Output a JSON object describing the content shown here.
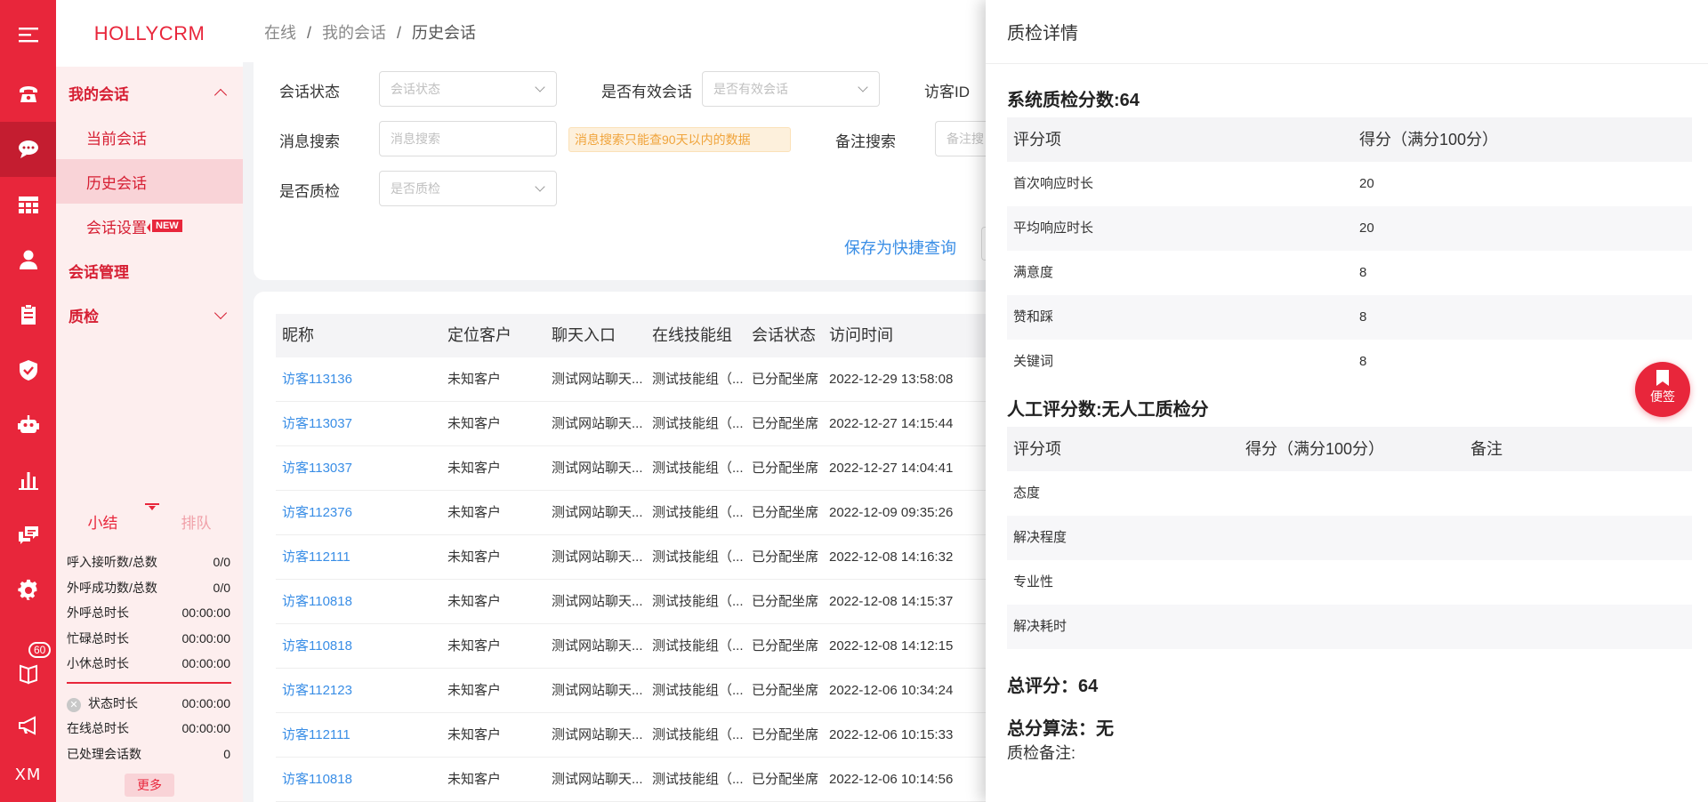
{
  "app": {
    "brand": "HOLLYCRM"
  },
  "rail": {
    "icons": [
      "menu-icon",
      "phone-icon",
      "chat-icon",
      "grid-icon",
      "user-icon",
      "clipboard-icon",
      "shield-icon",
      "robot-icon",
      "bar-chart-icon",
      "message-icon",
      "gear-icon",
      "book-icon",
      "megaphone-icon",
      "xm-icon"
    ],
    "badge": "60",
    "xm_label": "XM"
  },
  "menu": {
    "group1": "我的会话",
    "items": [
      "当前会话",
      "历史会话",
      "会话设置"
    ],
    "new_badge": "NEW",
    "group2": "会话管理",
    "group3": "质检"
  },
  "summary": {
    "tab1": "小结",
    "tab2": "排队",
    "rows": [
      {
        "label": "呼入接听数/总数",
        "value": "0/0"
      },
      {
        "label": "外呼成功数/总数",
        "value": "0/0"
      },
      {
        "label": "外呼总时长",
        "value": "00:00:00"
      },
      {
        "label": "忙碌总时长",
        "value": "00:00:00"
      },
      {
        "label": "小休总时长",
        "value": "00:00:00"
      }
    ],
    "rows2": [
      {
        "label": "状态时长",
        "value": "00:00:00"
      },
      {
        "label": "在线总时长",
        "value": "00:00:00"
      },
      {
        "label": "已处理会话数",
        "value": "0"
      }
    ],
    "more": "更多"
  },
  "breadcrumb": [
    "在线",
    "我的会话",
    "历史会话"
  ],
  "filters": {
    "status_label": "会话状态",
    "status_placeholder": "会话状态",
    "valid_label": "是否有效会话",
    "valid_placeholder": "是否有效会话",
    "visitor_label": "访客ID",
    "msg_label": "消息搜索",
    "msg_placeholder": "消息搜索",
    "msg_tip": "消息搜索只能查90天以内的数据",
    "remark_label": "备注搜索",
    "remark_placeholder": "备注搜",
    "qc_label": "是否质检",
    "qc_placeholder": "是否质检",
    "save_link": "保存为快捷查询"
  },
  "table": {
    "headers": [
      "昵称",
      "定位客户",
      "聊天入口",
      "在线技能组",
      "会话状态",
      "访问时间"
    ],
    "rows": [
      [
        "访客113136",
        "未知客户",
        "测试网站聊天...",
        "测试技能组（...",
        "已分配坐席",
        "2022-12-29 13:58:08"
      ],
      [
        "访客113037",
        "未知客户",
        "测试网站聊天...",
        "测试技能组（...",
        "已分配坐席",
        "2022-12-27 14:15:44"
      ],
      [
        "访客113037",
        "未知客户",
        "测试网站聊天...",
        "测试技能组（...",
        "已分配坐席",
        "2022-12-27 14:04:41"
      ],
      [
        "访客112376",
        "未知客户",
        "测试网站聊天...",
        "测试技能组（...",
        "已分配坐席",
        "2022-12-09 09:35:26"
      ],
      [
        "访客112111",
        "未知客户",
        "测试网站聊天...",
        "测试技能组（...",
        "已分配坐席",
        "2022-12-08 14:16:32"
      ],
      [
        "访客110818",
        "未知客户",
        "测试网站聊天...",
        "测试技能组（...",
        "已分配坐席",
        "2022-12-08 14:15:37"
      ],
      [
        "访客110818",
        "未知客户",
        "测试网站聊天...",
        "测试技能组（...",
        "已分配坐席",
        "2022-12-08 14:12:15"
      ],
      [
        "访客112123",
        "未知客户",
        "测试网站聊天...",
        "测试技能组（...",
        "已分配坐席",
        "2022-12-06 10:34:24"
      ],
      [
        "访客112111",
        "未知客户",
        "测试网站聊天...",
        "测试技能组（...",
        "已分配坐席",
        "2022-12-06 10:15:33"
      ],
      [
        "访客110818",
        "未知客户",
        "测试网站聊天...",
        "测试技能组（...",
        "已分配坐席",
        "2022-12-06 10:14:56"
      ]
    ]
  },
  "drawer": {
    "title": "质检详情",
    "system_title": "系统质检分数:64",
    "system_headers": [
      "评分项",
      "得分（满分100分）"
    ],
    "system_rows": [
      [
        "首次响应时长",
        "20"
      ],
      [
        "平均响应时长",
        "20"
      ],
      [
        "满意度",
        "8"
      ],
      [
        "赞和踩",
        "8"
      ],
      [
        "关键词",
        "8"
      ]
    ],
    "manual_title": "人工评分数:无人工质检分",
    "manual_headers": [
      "评分项",
      "得分（满分100分）",
      "备注"
    ],
    "manual_rows": [
      "态度",
      "解决程度",
      "专业性",
      "解决耗时"
    ],
    "total": "总评分：64",
    "algorithm": "总分算法：无",
    "note_label": "质检备注:"
  },
  "sticky": {
    "label": "便签"
  },
  "colors": {
    "brand": "#e8263b",
    "link": "#3a8ee6",
    "tip": "#f0a43c"
  }
}
